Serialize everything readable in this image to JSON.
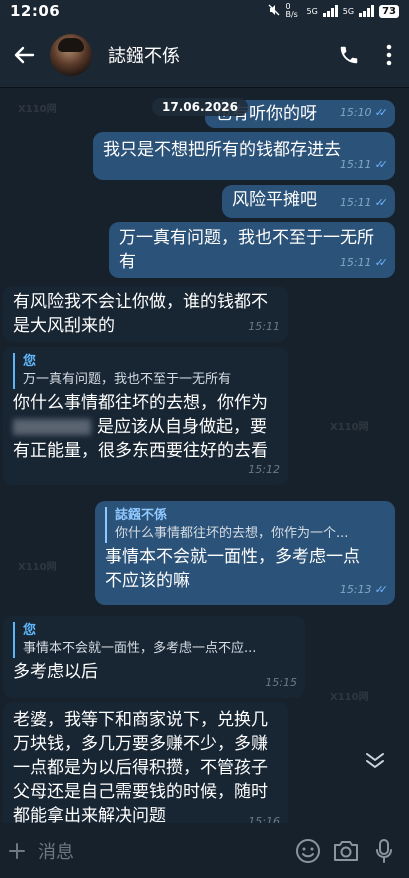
{
  "status_bar": {
    "time": "12:06",
    "net_speed": "0 B/s",
    "sim1": "5G",
    "sim2": "5G",
    "battery": "73"
  },
  "header": {
    "contact_name": "誌鏹不係"
  },
  "date_label": "17.06.2026",
  "messages": [
    {
      "id": "m1",
      "side": "out",
      "text": "也有听你的呀",
      "time": "15:10"
    },
    {
      "id": "m2",
      "side": "out",
      "text": "我只是不想把所有的钱都存进去",
      "time": "15:11"
    },
    {
      "id": "m3",
      "side": "out",
      "text": "风险平摊吧",
      "time": "15:11"
    },
    {
      "id": "m4",
      "side": "out",
      "text_line1": "万一真有问题，我也不至于一无所",
      "text_line2": "有",
      "time": "15:11"
    },
    {
      "id": "m5",
      "side": "in",
      "text_line1": "有风险我不会让你做，谁的钱都不",
      "text_line2": "是大风刮来的",
      "time": "15:11"
    },
    {
      "id": "m6",
      "side": "in",
      "quote_name": "您",
      "quote_text": "万一真有问题，我也不至于一无所有",
      "text_line1": "你什么事情都往坏的去想，你作为",
      "text_line2_after": "是应该从自身做起，要",
      "text_line3": "有正能量，很多东西要往好的去看",
      "time": "15:12"
    },
    {
      "id": "m7",
      "side": "out",
      "quote_name": "誌鏹不係",
      "quote_text": "你什么事情都往坏的去想，你作为一个...",
      "text_line1": "事情本不会就一面性，多考虑一点",
      "text_line2": "不应该的嘛",
      "time": "15:13"
    },
    {
      "id": "m8",
      "side": "in",
      "quote_name": "您",
      "quote_text": "事情本不会就一面性，多考虑一点不应...",
      "text": "多考虑以后",
      "time": "15:15"
    },
    {
      "id": "m9",
      "side": "in",
      "text_line1": "老婆，我等下和商家说下，兑换几",
      "text_line2": "万块钱，多几万要多赚不少，多赚",
      "text_line3": "一点都是为以后得积攒，不管孩子",
      "text_line4": "父母还是自己需要钱的时候，随时",
      "text_line5": "都能拿出来解决问题",
      "time": "15:16"
    }
  ],
  "input": {
    "placeholder": "消息"
  },
  "watermark": "X110网",
  "colors": {
    "background": "#17212b",
    "outgoing": "#2b5278",
    "incoming": "#182533",
    "accent": "#5eb5f7"
  }
}
